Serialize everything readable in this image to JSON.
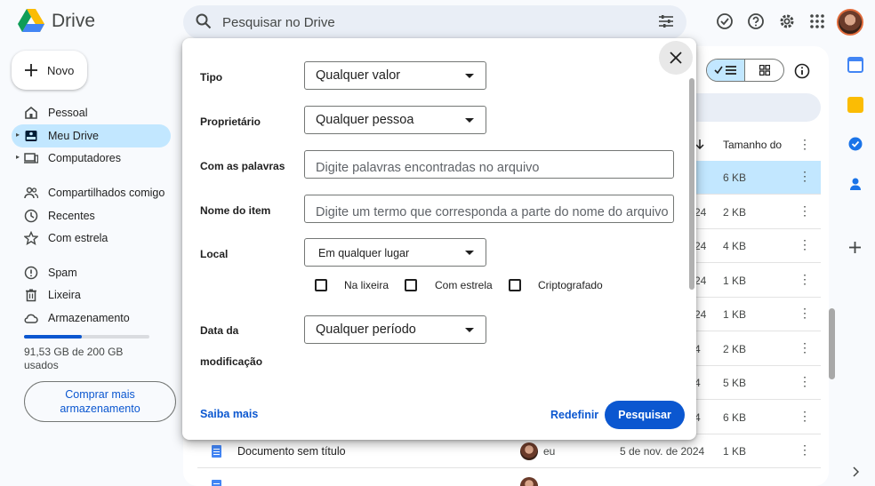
{
  "header": {
    "app_name": "Drive",
    "search_placeholder": "Pesquisar no Drive"
  },
  "sidebar": {
    "new_label": "Novo",
    "items": [
      {
        "label": "Pessoal"
      },
      {
        "label": "Meu Drive"
      },
      {
        "label": "Computadores"
      },
      {
        "label": "Compartilhados comigo"
      },
      {
        "label": "Recentes"
      },
      {
        "label": "Com estrela"
      },
      {
        "label": "Spam"
      },
      {
        "label": "Lixeira"
      },
      {
        "label": "Armazenamento"
      }
    ],
    "storage_used_fraction": 0.46,
    "storage_text": "91,53 GB de 200 GB usados",
    "buy_label": "Comprar mais armazenamento"
  },
  "table": {
    "size_header": "Tamanho do",
    "rows": [
      {
        "date": "",
        "size": "6 KB"
      },
      {
        "date": "24",
        "size": "2 KB"
      },
      {
        "date": "24",
        "size": "4 KB"
      },
      {
        "date": "24",
        "size": "1 KB"
      },
      {
        "date": "24",
        "size": "1 KB"
      },
      {
        "date": "4",
        "size": "2 KB"
      },
      {
        "date": "4",
        "size": "5 KB"
      },
      {
        "date": "4",
        "size": "6 KB"
      }
    ],
    "last_row": {
      "name": "Documento sem título",
      "owner": "eu",
      "date": "5 de nov. de 2024",
      "size": "1 KB"
    }
  },
  "dialog": {
    "type_label": "Tipo",
    "type_value": "Qualquer valor",
    "owner_label": "Proprietário",
    "owner_value": "Qualquer pessoa",
    "words_label": "Com as palavras",
    "words_placeholder": "Digite palavras encontradas no arquivo",
    "item_name_label": "Nome do item",
    "item_name_placeholder": "Digite um termo que corresponda a parte do nome do arquivo",
    "location_label": "Local",
    "location_value": "Em qualquer lugar",
    "checkbox_trash": "Na lixeira",
    "checkbox_starred": "Com estrela",
    "checkbox_encrypted": "Criptografado",
    "date_label_1": "Data da",
    "date_label_2": "modificação",
    "date_value": "Qualquer período",
    "learn_more": "Saiba mais",
    "reset": "Redefinir",
    "search": "Pesquisar"
  }
}
